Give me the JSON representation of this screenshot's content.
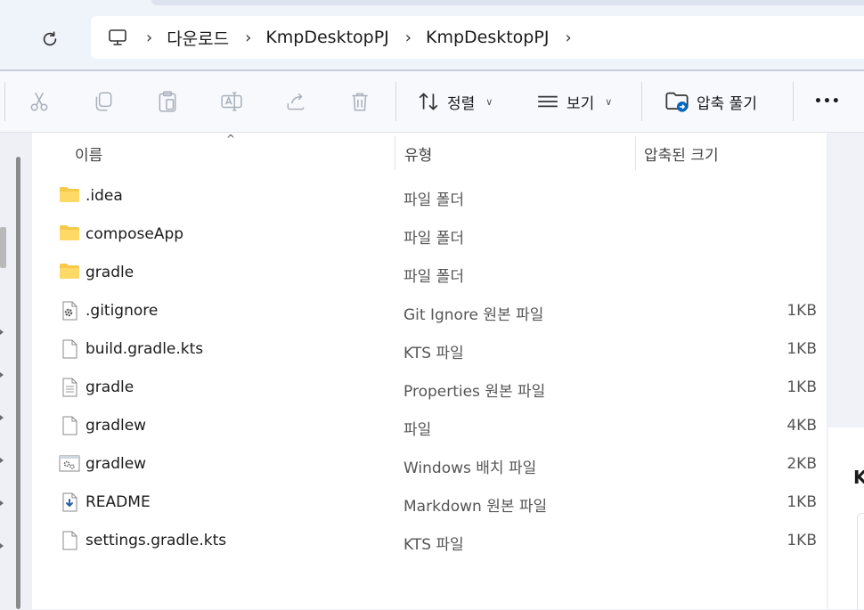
{
  "breadcrumb": {
    "items": [
      "다운로드",
      "KmpDesktopPJ",
      "KmpDesktopPJ"
    ]
  },
  "toolbar": {
    "sort_label": "정렬",
    "view_label": "보기",
    "extract_label": "압축 풀기",
    "more_label": "•••"
  },
  "columns": {
    "name": "이름",
    "type": "유형",
    "size": "압축된 크기"
  },
  "files": [
    {
      "icon": "folder-icon",
      "name": ".idea",
      "type": "파일 폴더",
      "size": ""
    },
    {
      "icon": "folder-icon",
      "name": "composeApp",
      "type": "파일 폴더",
      "size": ""
    },
    {
      "icon": "folder-icon",
      "name": "gradle",
      "type": "파일 폴더",
      "size": ""
    },
    {
      "icon": "gear-file-icon",
      "name": ".gitignore",
      "type": "Git Ignore 원본 파일",
      "size": "1KB"
    },
    {
      "icon": "file-icon",
      "name": "build.gradle.kts",
      "type": "KTS 파일",
      "size": "1KB"
    },
    {
      "icon": "text-file-icon",
      "name": "gradle",
      "type": "Properties 원본 파일",
      "size": "1KB"
    },
    {
      "icon": "file-icon",
      "name": "gradlew",
      "type": "파일",
      "size": "4KB"
    },
    {
      "icon": "batch-file-icon",
      "name": "gradlew",
      "type": "Windows 배치 파일",
      "size": "2KB"
    },
    {
      "icon": "markdown-file-icon",
      "name": "README",
      "type": "Markdown 원본 파일",
      "size": "1KB"
    },
    {
      "icon": "file-icon",
      "name": "settings.gradle.kts",
      "type": "KTS 파일",
      "size": "1KB"
    }
  ],
  "right_pane": {
    "partial_text": "K"
  },
  "colors": {
    "folder": "#f6c94a",
    "accent": "#0067c0"
  }
}
